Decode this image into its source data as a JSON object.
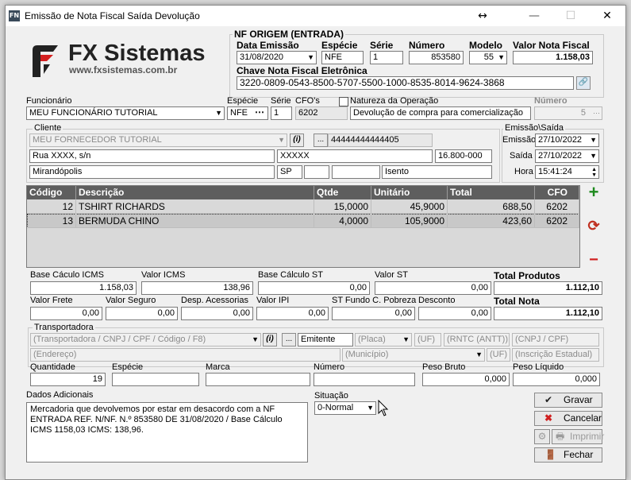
{
  "window": {
    "title": "Emissão de Nota Fiscal Saída Devolução",
    "app_icon": "FN",
    "controls": {
      "move": "↔",
      "minimize": "—",
      "maximize": "☐",
      "close": "✕"
    }
  },
  "logo": {
    "name": "FX Sistemas",
    "url": "www.fxsistemas.com.br"
  },
  "nf_origem": {
    "title": "NF ORIGEM (ENTRADA)",
    "data_emissao_label": "Data Emissão",
    "data_emissao": "31/08/2020",
    "especie_label": "Espécie",
    "especie": "NFE",
    "serie_label": "Série",
    "serie": "1",
    "numero_label": "Número",
    "numero": "853580",
    "modelo_label": "Modelo",
    "modelo": "55",
    "valor_label": "Valor Nota Fiscal",
    "valor": "1.158,03",
    "chave_label": "Chave Nota Fiscal Eletrônica",
    "chave": "3220-0809-0543-8500-5707-5500-1000-8535-8014-9624-3868"
  },
  "header": {
    "funcionario_label": "Funcionário",
    "funcionario": "MEU FUNCIONÁRIO TUTORIAL",
    "especie_label": "Espécie",
    "especie": "NFE",
    "serie_label": "Série",
    "serie": "1",
    "cfos_label": "CFO's",
    "cfos": "6202",
    "natureza_label": "Natureza da Operação",
    "natureza": "Devolução de compra para comercialização",
    "numero_label": "Número",
    "numero": "5"
  },
  "cliente": {
    "label": "Cliente",
    "nome": "MEU FORNECEDOR TUTORIAL",
    "info_btn": "(i)",
    "more_btn": "...",
    "cnpj": "44444444444405",
    "endereco": "Rua XXXX, s/n",
    "bairro": "XXXXX",
    "cep": "16.800-000",
    "cidade": "Mirandópolis",
    "uf": "SP",
    "campo1": "",
    "campo2": "",
    "ie": "Isento"
  },
  "emissao_saida": {
    "label": "Emissão\\Saída",
    "emissao_label": "Emissão",
    "emissao": "27/10/2022",
    "saida_label": "Saída",
    "saida": "27/10/2022",
    "hora_label": "Hora",
    "hora": "15:41:24"
  },
  "items_table": {
    "columns": [
      "Código",
      "Descrição",
      "Qtde",
      "Unitário",
      "Total",
      "CFO"
    ],
    "rows": [
      {
        "codigo": "12",
        "descricao": "TSHIRT RICHARDS",
        "qtde": "15,0000",
        "unitario": "45,9000",
        "total": "688,50",
        "cfo": "6202"
      },
      {
        "codigo": "13",
        "descricao": "BERMUDA CHINO",
        "qtde": "4,0000",
        "unitario": "105,9000",
        "total": "423,60",
        "cfo": "6202"
      }
    ]
  },
  "side_buttons": {
    "add": "+",
    "refresh": "⟳",
    "remove": "−"
  },
  "totais": {
    "base_icms_label": "Base Cáculo ICMS",
    "base_icms": "1.158,03",
    "valor_icms_label": "Valor ICMS",
    "valor_icms": "138,96",
    "base_st_label": "Base Cálculo ST",
    "base_st": "0,00",
    "valor_st_label": "Valor ST",
    "valor_st": "0,00",
    "total_produtos_label": "Total Produtos",
    "total_produtos": "1.112,10",
    "frete_label": "Valor Frete",
    "frete": "0,00",
    "seguro_label": "Valor Seguro",
    "seguro": "0,00",
    "acessorias_label": "Desp. Acessorias",
    "acessorias": "0,00",
    "ipi_label": "Valor IPI",
    "ipi": "0,00",
    "fcp_label": "ST Fundo C. Pobreza",
    "fcp": "0,00",
    "desconto_label": "Desconto",
    "desconto": "0,00",
    "total_nota_label": "Total Nota",
    "total_nota": "1.112,10"
  },
  "transportadora": {
    "label": "Transportadora",
    "search_placeholder": "(Transportadora / CNPJ / CPF / Código / F8)",
    "info_btn": "(i)",
    "more_btn": "...",
    "frete_por": "Emitente",
    "placa": "(Placa)",
    "uf": "(UF)",
    "rntc": "(RNTC (ANTT))",
    "cnpj": "(CNPJ / CPF)",
    "endereco": "(Endereço)",
    "municipio": "(Município)",
    "uf2": "(UF)",
    "ie": "(Inscrição Estadual)",
    "quantidade_label": "Quantidade",
    "quantidade": "19",
    "especie_label": "Espécie",
    "especie": "",
    "marca_label": "Marca",
    "marca": "",
    "numero_label": "Número",
    "numero": "",
    "peso_bruto_label": "Peso Bruto",
    "peso_bruto": "0,000",
    "peso_liquido_label": "Peso Líquido",
    "peso_liquido": "0,000"
  },
  "dados_adicionais": {
    "label": "Dados Adicionais",
    "text": "Mercadoria que devolvemos por estar em desacordo com a NF ENTRADA REF. N/NF. N.º 853580 DE 31/08/2020 / Base Cálculo ICMS 1158,03 ICMS: 138,96."
  },
  "situacao": {
    "label": "Situação",
    "value": "0-Normal"
  },
  "actions": {
    "gravar": "Gravar",
    "cancelar": "Cancelar",
    "imprimir": "Imprimir",
    "fechar": "Fechar"
  },
  "colors": {
    "grid_header": "#5e5e5e",
    "add_green": "#1e8a1e",
    "remove_red": "#d02020"
  }
}
